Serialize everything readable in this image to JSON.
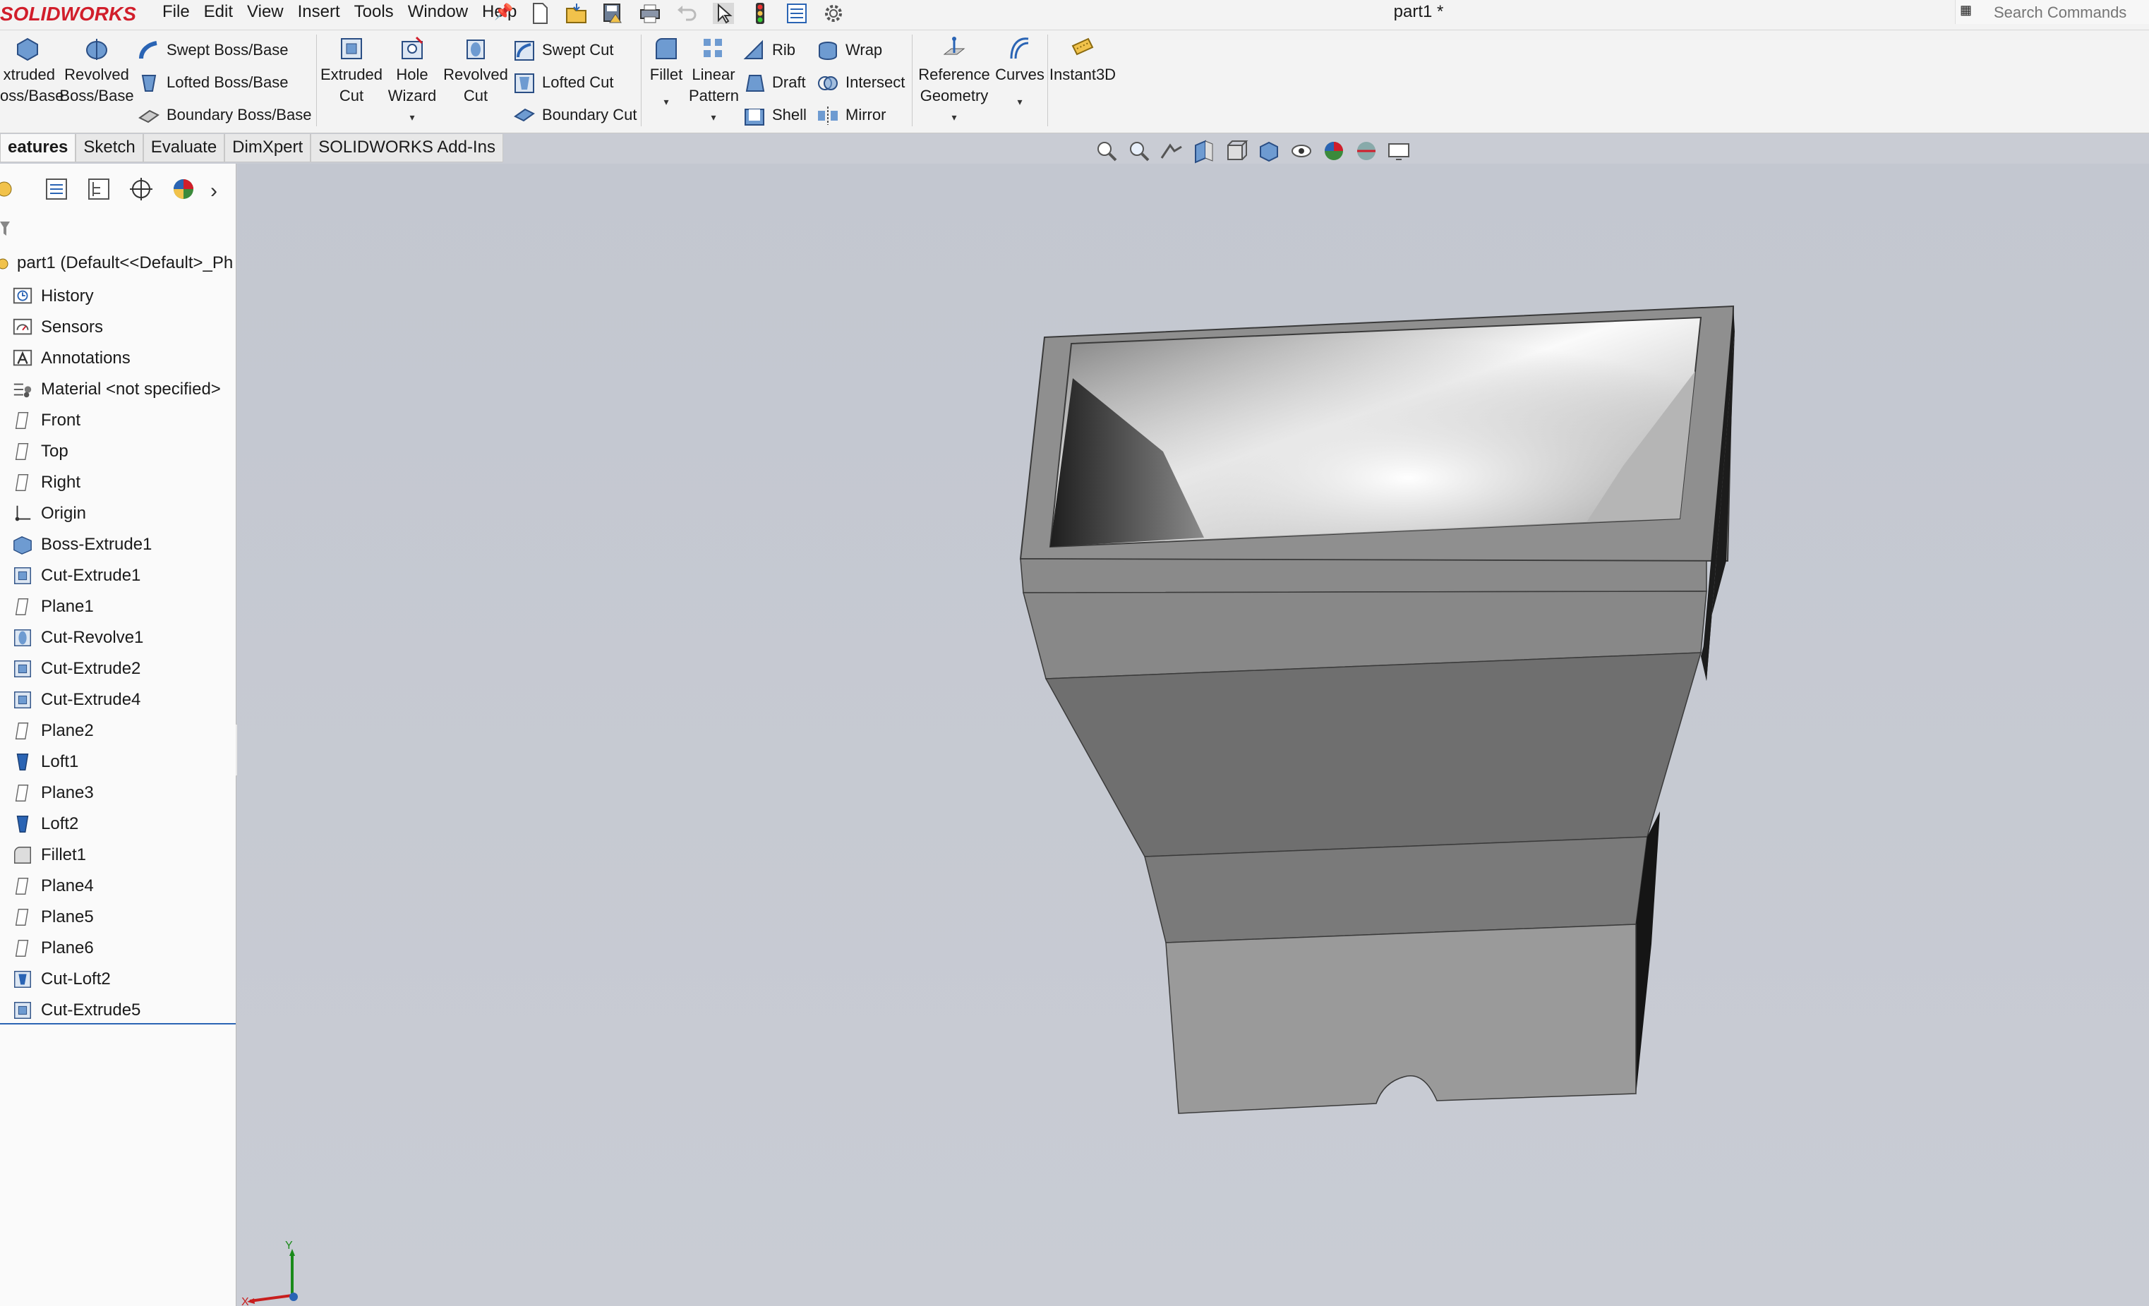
{
  "app": {
    "logo": "SOLIDWORKS",
    "menu": [
      "File",
      "Edit",
      "View",
      "Insert",
      "Tools",
      "Window",
      "Help"
    ],
    "document_title": "part1 *",
    "search_placeholder": "Search Commands"
  },
  "ribbon": {
    "extruded_boss": "xtruded\noss/Base",
    "revolved_boss": "Revolved\nBoss/Base",
    "swept_boss": "Swept Boss/Base",
    "lofted_boss": "Lofted Boss/Base",
    "boundary_boss": "Boundary Boss/Base",
    "extruded_cut": "Extruded\nCut",
    "hole_wizard": "Hole\nWizard",
    "revolved_cut": "Revolved\nCut",
    "swept_cut": "Swept Cut",
    "lofted_cut": "Lofted Cut",
    "boundary_cut": "Boundary Cut",
    "fillet": "Fillet",
    "linear_pattern": "Linear\nPattern",
    "rib": "Rib",
    "draft": "Draft",
    "shell": "Shell",
    "wrap": "Wrap",
    "intersect": "Intersect",
    "mirror": "Mirror",
    "reference_geometry": "Reference\nGeometry",
    "curves": "Curves",
    "instant3d": "Instant3D"
  },
  "tabs": [
    "eatures",
    "Sketch",
    "Evaluate",
    "DimXpert",
    "SOLIDWORKS Add-Ins"
  ],
  "feature_tree": {
    "root": "part1  (Default<<Default>_Ph",
    "items": [
      {
        "label": "History",
        "icon": "history-icon"
      },
      {
        "label": "Sensors",
        "icon": "sensors-icon"
      },
      {
        "label": "Annotations",
        "icon": "annotations-icon"
      },
      {
        "label": "Material <not specified>",
        "icon": "material-icon"
      },
      {
        "label": "Front",
        "icon": "plane-icon"
      },
      {
        "label": "Top",
        "icon": "plane-icon"
      },
      {
        "label": "Right",
        "icon": "plane-icon"
      },
      {
        "label": "Origin",
        "icon": "origin-icon"
      },
      {
        "label": "Boss-Extrude1",
        "icon": "boss-extrude-icon"
      },
      {
        "label": "Cut-Extrude1",
        "icon": "cut-extrude-icon"
      },
      {
        "label": "Plane1",
        "icon": "plane-icon"
      },
      {
        "label": "Cut-Revolve1",
        "icon": "cut-revolve-icon"
      },
      {
        "label": "Cut-Extrude2",
        "icon": "cut-extrude-icon"
      },
      {
        "label": "Cut-Extrude4",
        "icon": "cut-extrude-icon"
      },
      {
        "label": "Plane2",
        "icon": "plane-icon"
      },
      {
        "label": "Loft1",
        "icon": "loft-icon"
      },
      {
        "label": "Plane3",
        "icon": "plane-icon"
      },
      {
        "label": "Loft2",
        "icon": "loft-icon"
      },
      {
        "label": "Fillet1",
        "icon": "fillet-icon"
      },
      {
        "label": "Plane4",
        "icon": "plane-icon"
      },
      {
        "label": "Plane5",
        "icon": "plane-icon"
      },
      {
        "label": "Plane6",
        "icon": "plane-icon"
      },
      {
        "label": "Cut-Loft2",
        "icon": "cut-loft-icon"
      },
      {
        "label": "Cut-Extrude5",
        "icon": "cut-extrude-icon"
      }
    ]
  },
  "triad": {
    "x_label": "X",
    "y_label": "Y"
  },
  "colors": {
    "brand_red": "#d11e2b",
    "accent_blue": "#2a64b4",
    "model_gray": "#8a8a8a",
    "viewport_bg": "#c9ccd4"
  }
}
